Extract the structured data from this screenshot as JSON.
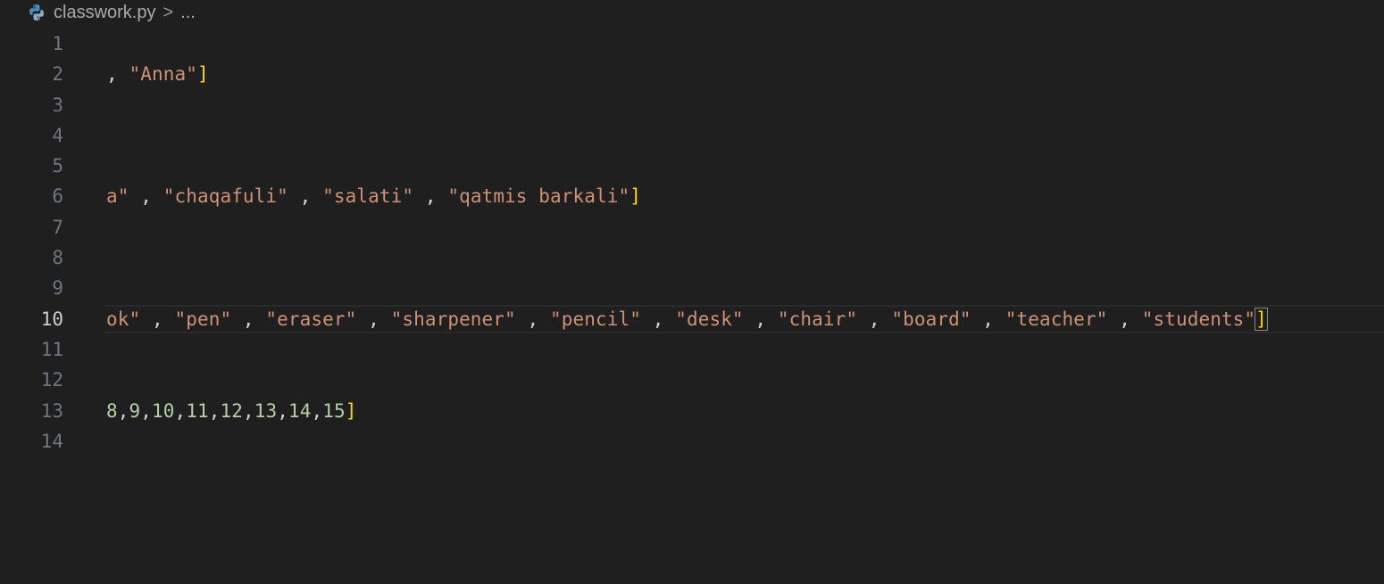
{
  "breadcrumb": {
    "file_icon": "python-icon",
    "file_name": "classwork.py",
    "separator": ">",
    "more": "..."
  },
  "editor": {
    "active_line": 10,
    "lines": [
      {
        "number": "1",
        "tokens": []
      },
      {
        "number": "2",
        "tokens": [
          {
            "text": ", ",
            "kind": "punc"
          },
          {
            "text": "\"Anna\"",
            "kind": "str"
          },
          {
            "text": "]",
            "kind": "bracket"
          }
        ]
      },
      {
        "number": "3",
        "tokens": []
      },
      {
        "number": "4",
        "tokens": []
      },
      {
        "number": "5",
        "tokens": []
      },
      {
        "number": "6",
        "tokens": [
          {
            "text": "a\"",
            "kind": "str"
          },
          {
            "text": " , ",
            "kind": "punc"
          },
          {
            "text": "\"chaqafuli\"",
            "kind": "str"
          },
          {
            "text": " , ",
            "kind": "punc"
          },
          {
            "text": "\"salati\"",
            "kind": "str"
          },
          {
            "text": " , ",
            "kind": "punc"
          },
          {
            "text": "\"qatmis barkali\"",
            "kind": "str"
          },
          {
            "text": "]",
            "kind": "bracket"
          }
        ]
      },
      {
        "number": "7",
        "tokens": []
      },
      {
        "number": "8",
        "tokens": []
      },
      {
        "number": "9",
        "tokens": []
      },
      {
        "number": "10",
        "tokens": [
          {
            "text": "ok\"",
            "kind": "str"
          },
          {
            "text": " , ",
            "kind": "punc"
          },
          {
            "text": "\"pen\"",
            "kind": "str"
          },
          {
            "text": " , ",
            "kind": "punc"
          },
          {
            "text": "\"eraser\"",
            "kind": "str"
          },
          {
            "text": " , ",
            "kind": "punc"
          },
          {
            "text": "\"sharpener\"",
            "kind": "str"
          },
          {
            "text": " , ",
            "kind": "punc"
          },
          {
            "text": "\"pencil\"",
            "kind": "str"
          },
          {
            "text": " , ",
            "kind": "punc"
          },
          {
            "text": "\"desk\"",
            "kind": "str"
          },
          {
            "text": " , ",
            "kind": "punc"
          },
          {
            "text": "\"chair\"",
            "kind": "str"
          },
          {
            "text": " , ",
            "kind": "punc"
          },
          {
            "text": "\"board\"",
            "kind": "str"
          },
          {
            "text": " , ",
            "kind": "punc"
          },
          {
            "text": "\"teacher\"",
            "kind": "str"
          },
          {
            "text": " , ",
            "kind": "punc"
          },
          {
            "text": "\"students\"",
            "kind": "str"
          },
          {
            "text": "]",
            "kind": "bracket matched"
          }
        ]
      },
      {
        "number": "11",
        "tokens": []
      },
      {
        "number": "12",
        "tokens": []
      },
      {
        "number": "13",
        "tokens": [
          {
            "text": "8",
            "kind": "num"
          },
          {
            "text": ",",
            "kind": "punc"
          },
          {
            "text": "9",
            "kind": "num"
          },
          {
            "text": ",",
            "kind": "punc"
          },
          {
            "text": "10",
            "kind": "num"
          },
          {
            "text": ",",
            "kind": "punc"
          },
          {
            "text": "11",
            "kind": "num"
          },
          {
            "text": ",",
            "kind": "punc"
          },
          {
            "text": "12",
            "kind": "num"
          },
          {
            "text": ",",
            "kind": "punc"
          },
          {
            "text": "13",
            "kind": "num"
          },
          {
            "text": ",",
            "kind": "punc"
          },
          {
            "text": "14",
            "kind": "num"
          },
          {
            "text": ",",
            "kind": "punc"
          },
          {
            "text": "15",
            "kind": "num"
          },
          {
            "text": "]",
            "kind": "bracket"
          }
        ]
      },
      {
        "number": "14",
        "tokens": []
      }
    ]
  }
}
